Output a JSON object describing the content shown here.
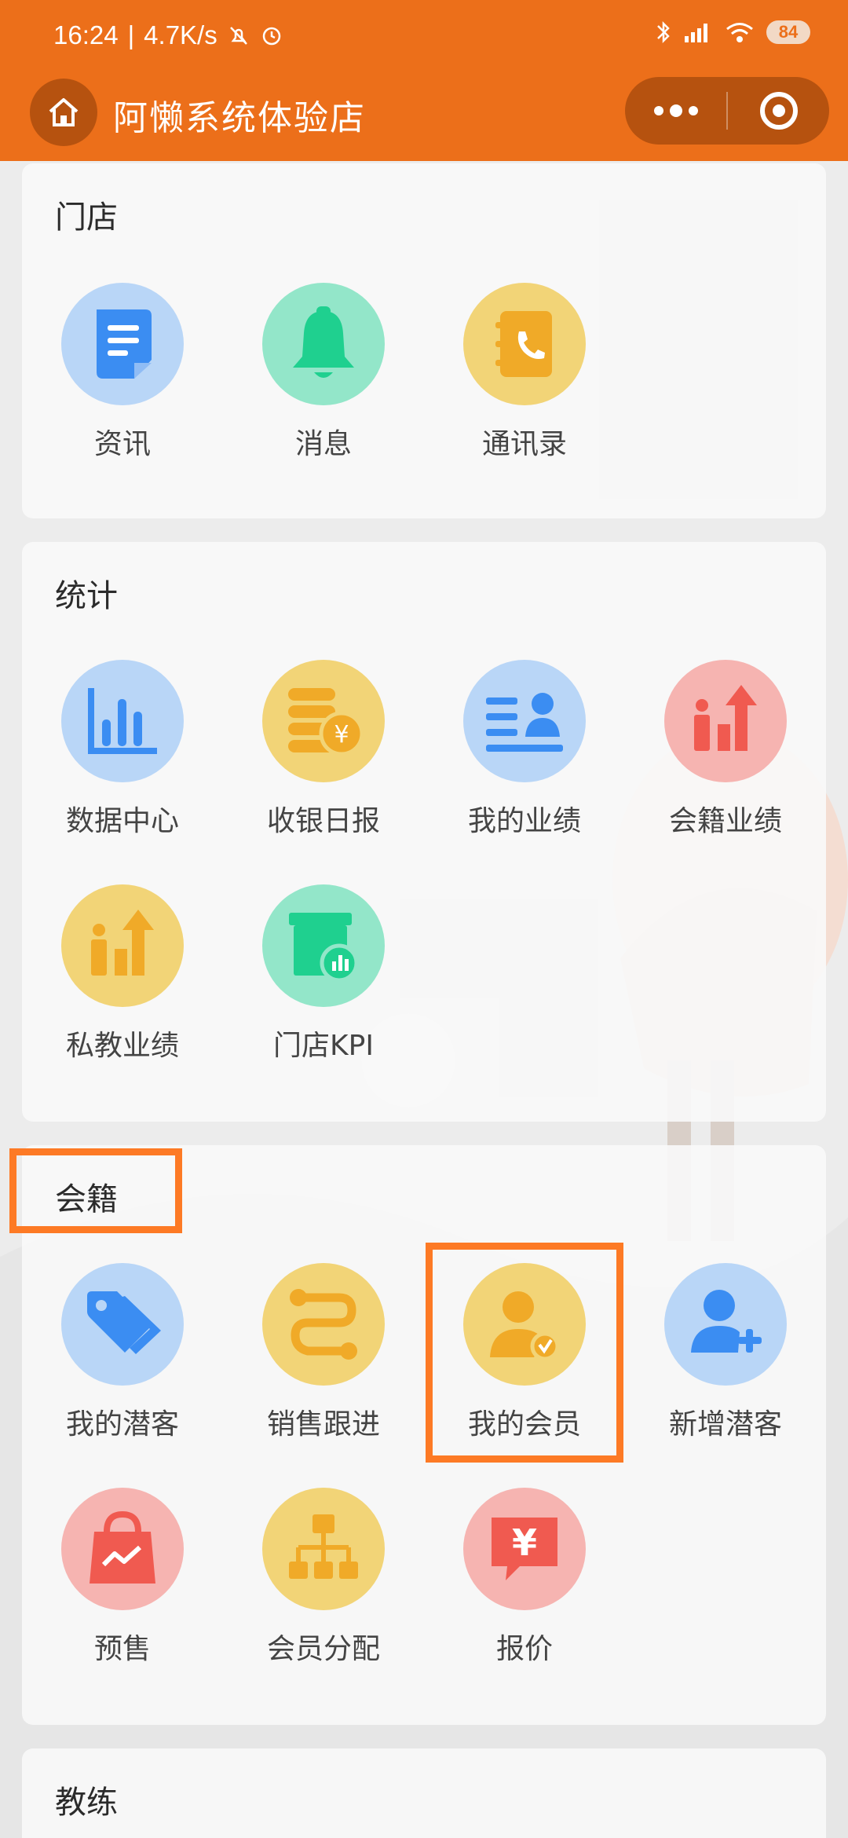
{
  "status_bar": {
    "time": "16:24",
    "speed": "4.7K/s",
    "battery": "84"
  },
  "navbar": {
    "title": "阿懒系统体验店"
  },
  "sections": {
    "store": {
      "title": "门店",
      "items": [
        "资讯",
        "消息",
        "通讯录"
      ]
    },
    "stats": {
      "title": "统计",
      "items": [
        "数据中心",
        "收银日报",
        "我的业绩",
        "会籍业绩",
        "私教业绩",
        "门店KPI"
      ]
    },
    "membership": {
      "title": "会籍",
      "items": [
        "我的潜客",
        "销售跟进",
        "我的会员",
        "新增潜客",
        "预售",
        "会员分配",
        "报价"
      ]
    },
    "coach": {
      "title": "教练"
    }
  },
  "colors": {
    "brand": "#ec6f1a",
    "highlight": "#fd7a25",
    "blue": "#3b8df2",
    "green": "#1fd08f",
    "yellow": "#f0aa28",
    "red": "#f05a50"
  }
}
